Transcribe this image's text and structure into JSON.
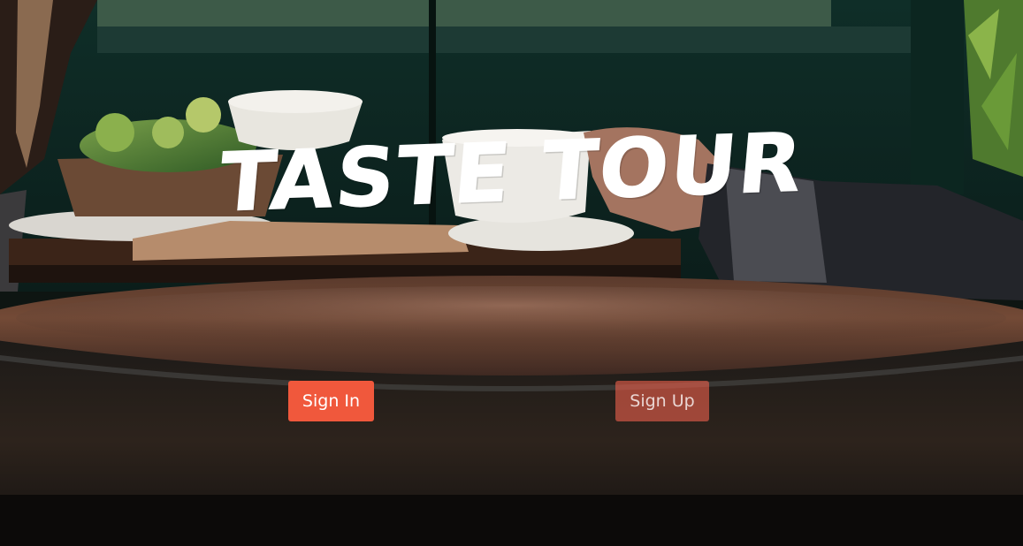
{
  "hero": {
    "title": "TASTE TOUR"
  },
  "actions": {
    "sign_in_label": "Sign In",
    "sign_up_label": "Sign Up"
  },
  "colors": {
    "accent": "#f0583c",
    "title_text": "#ffffff"
  }
}
